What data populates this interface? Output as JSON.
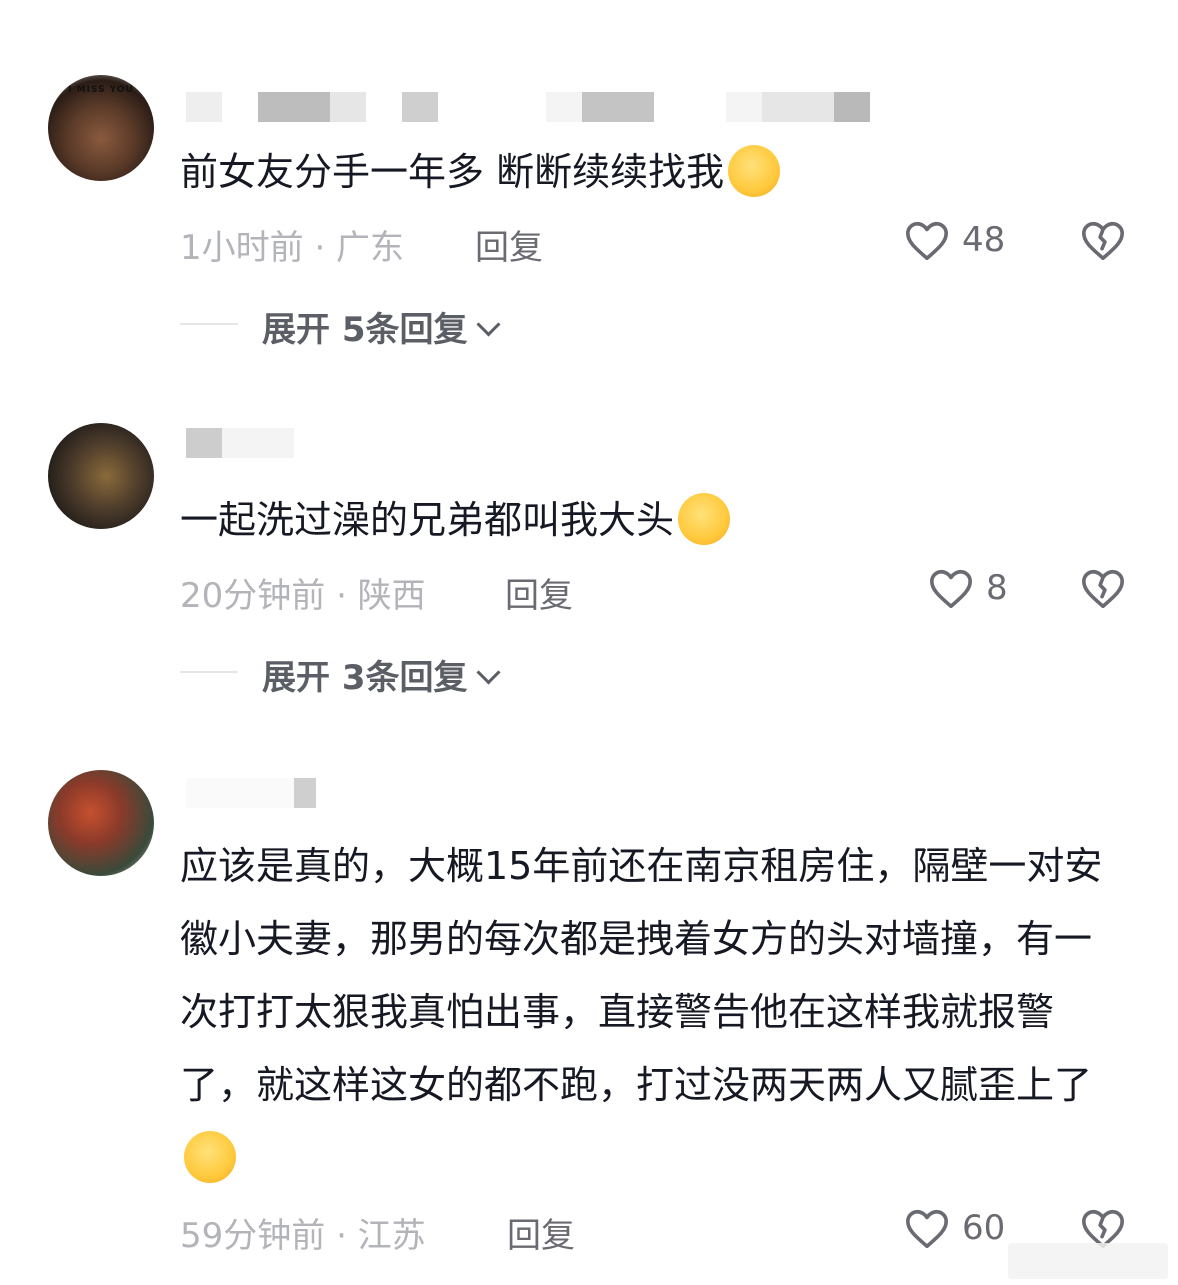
{
  "comments": [
    {
      "text": "前女友分手一年多 断断续续找我",
      "time_location": "1小时前 · 广东",
      "reply_label": "回复",
      "likes": "48",
      "expand_label": "展开 5条回复",
      "emoji": "smirk-emoji"
    },
    {
      "text": "一起洗过澡的兄弟都叫我大头",
      "time_location": "20分钟前 · 陕西",
      "reply_label": "回复",
      "likes": "8",
      "expand_label": "展开 3条回复",
      "emoji": "grin-emoji"
    },
    {
      "text": "应该是真的，大概15年前还在南京租房住，隔壁一对安徽小夫妻，那男的每次都是拽着女方的头对墙撞，有一次打打太狠我真怕出事，直接警告他在这样我就报警了，就这样这女的都不跑，打过没两天两人又腻歪上了",
      "time_location": "59分钟前 · 江苏",
      "reply_label": "回复",
      "likes": "60",
      "emoji": "facepalm-laugh-emoji"
    }
  ],
  "colors": {
    "primary_text": "#161823",
    "secondary_text": "#b3b4b9",
    "action_text": "#6a6b72",
    "divider": "#e6e6e8"
  }
}
